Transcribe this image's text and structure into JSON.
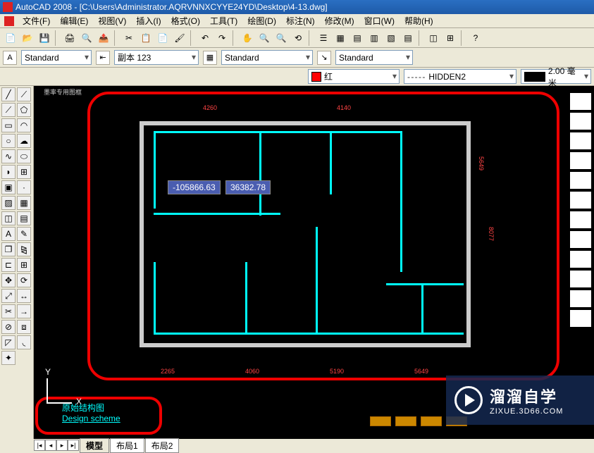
{
  "title": "AutoCAD 2008 - [C:\\Users\\Administrator.AQRVNNXCYYE24YD\\Desktop\\4-13.dwg]",
  "menu": {
    "file": "文件(F)",
    "edit": "编辑(E)",
    "view": "视图(V)",
    "insert": "插入(I)",
    "format": "格式(O)",
    "tools": "工具(T)",
    "draw": "绘图(D)",
    "dimension": "标注(N)",
    "modify": "修改(M)",
    "window": "窗口(W)",
    "help": "帮助(H)"
  },
  "style": {
    "text_style": "Standard",
    "dim_style": "副本 123",
    "table_style": "Standard",
    "mleader_style": "Standard"
  },
  "props": {
    "color_name": "红",
    "linetype": "HIDDEN2",
    "lineweight": "2.00 毫米"
  },
  "coords": {
    "x": "-105866.63",
    "y": "36382.78"
  },
  "tabs": {
    "model": "模型",
    "layout1": "布局1",
    "layout2": "布局2"
  },
  "title_block": {
    "line1": "原始结构图",
    "line2": "Design scheme"
  },
  "watermark": {
    "brand": "溜溜自学",
    "url": "ZIXUE.3D66.COM"
  },
  "ucs": {
    "x": "X",
    "y": "Y"
  },
  "dims": {
    "top1": "4260",
    "top2": "4140",
    "b1": "2265",
    "b2": "4060",
    "b3": "5190",
    "b4": "5649",
    "r1": "5649",
    "r2": "8077"
  },
  "frame_label": "墨率专用图框"
}
